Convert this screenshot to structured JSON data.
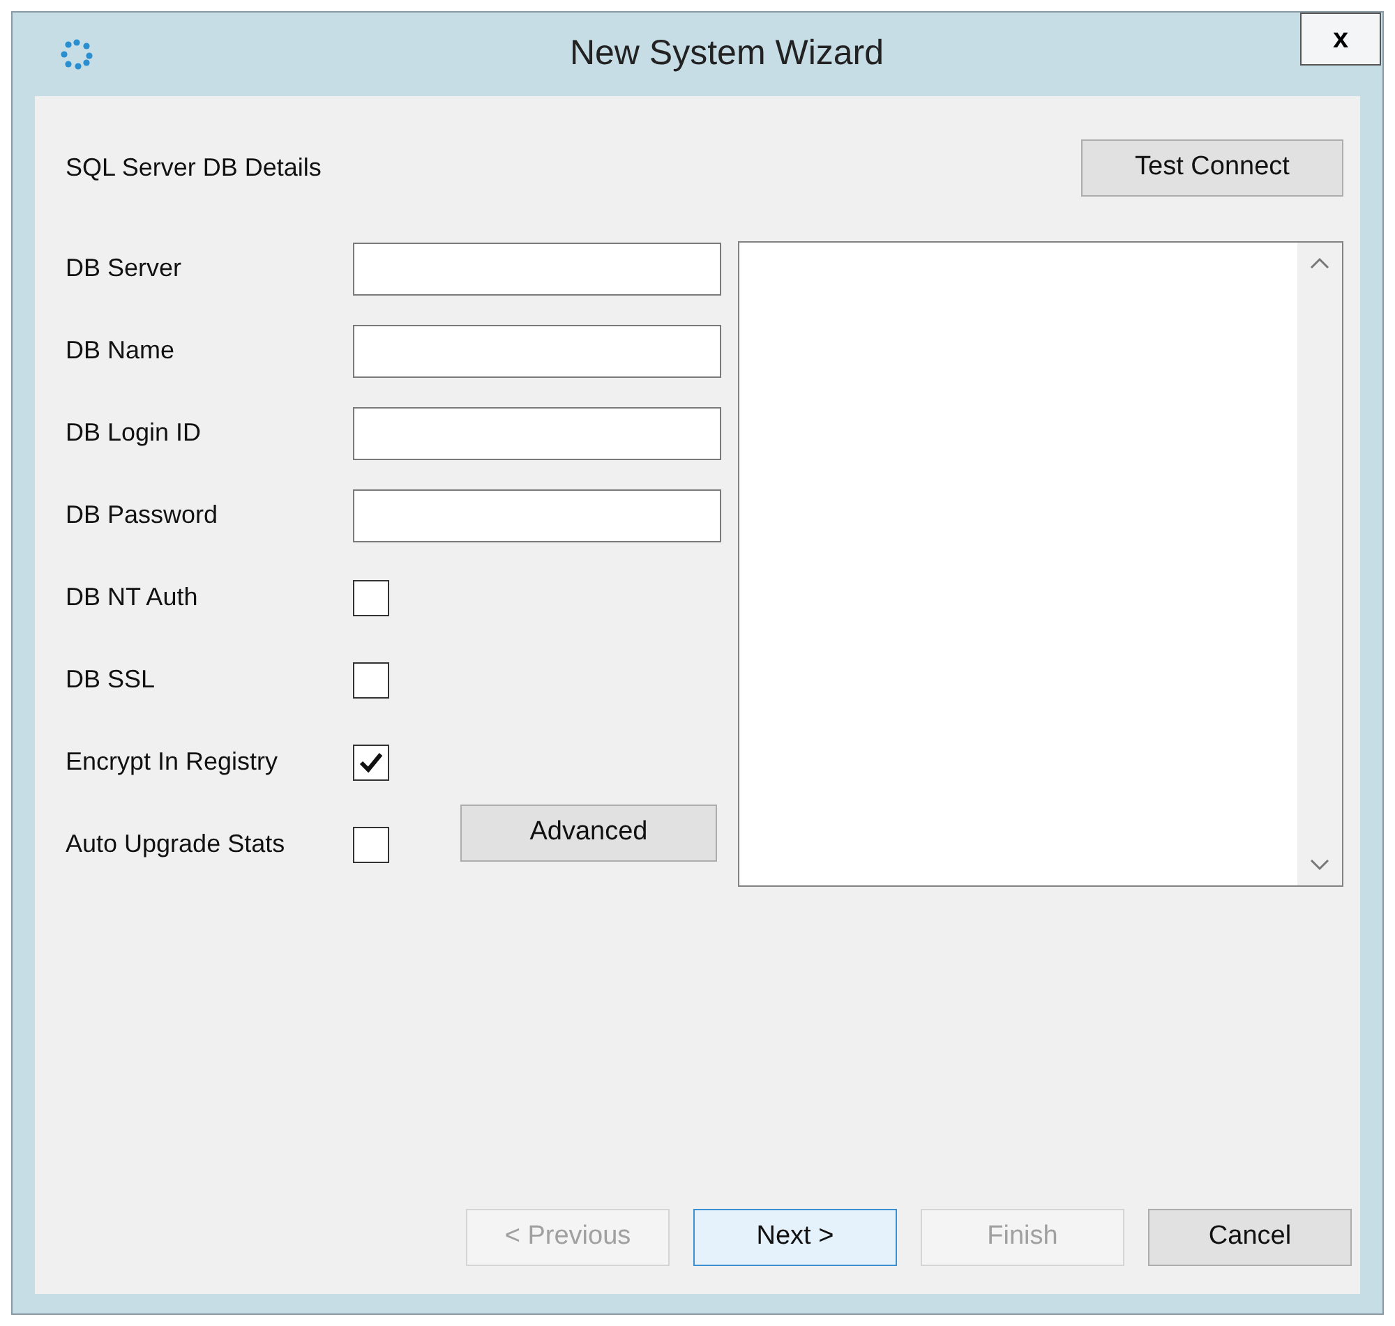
{
  "window": {
    "title": "New System Wizard",
    "close": "x"
  },
  "section_title": "SQL Server DB Details",
  "test_button": {
    "label": "Test Connect"
  },
  "fields": [
    {
      "label": "DB Server",
      "kind": "text"
    },
    {
      "label": "DB Name",
      "kind": "text"
    },
    {
      "label": "DB Login ID",
      "kind": "text"
    },
    {
      "label": "DB Password",
      "kind": "text"
    },
    {
      "label": "DB NT Auth",
      "kind": "checkbox",
      "checked": false
    },
    {
      "label": "DB SSL",
      "kind": "checkbox",
      "checked": false
    },
    {
      "label": "Encrypt In Registry",
      "kind": "checkbox",
      "checked": true
    },
    {
      "label": "Auto Upgrade Stats",
      "kind": "checkbox",
      "checked": false
    }
  ],
  "advanced_button": {
    "label": "Advanced"
  },
  "nav_buttons": [
    {
      "label": "< Previous",
      "disabled": true,
      "focused": false
    },
    {
      "label": "Next >",
      "disabled": false,
      "focused": true
    },
    {
      "label": "Finish",
      "disabled": true,
      "focused": false
    },
    {
      "label": "Cancel",
      "disabled": false,
      "focused": false
    }
  ]
}
